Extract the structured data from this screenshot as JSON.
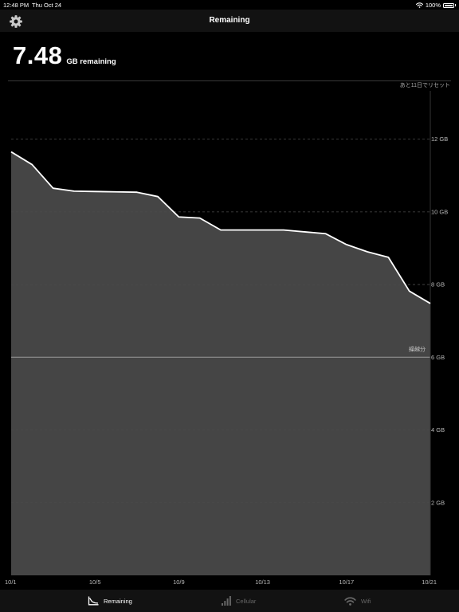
{
  "status_bar": {
    "time": "12:48 PM",
    "date": "Thu Oct 24",
    "battery": "100%"
  },
  "nav": {
    "title": "Remaining",
    "settings_icon": "gear-icon"
  },
  "summary": {
    "value": "7.48",
    "unit": "GB remaining"
  },
  "reset_note": "あと11日でリセット",
  "chart_data": {
    "type": "area",
    "x": [
      "10/1",
      "10/2",
      "10/3",
      "10/4",
      "10/5",
      "10/6",
      "10/7",
      "10/8",
      "10/9",
      "10/10",
      "10/11",
      "10/12",
      "10/13",
      "10/14",
      "10/15",
      "10/16",
      "10/17",
      "10/18",
      "10/19",
      "10/20",
      "10/21"
    ],
    "series": [
      {
        "values": [
          11.65,
          11.3,
          10.65,
          10.57,
          10.56,
          10.55,
          10.54,
          10.42,
          9.86,
          9.83,
          9.5,
          9.5,
          9.5,
          9.5,
          9.45,
          9.4,
          9.1,
          8.9,
          8.75,
          7.82,
          7.48
        ]
      }
    ],
    "x_tick_labels": [
      "10/1",
      "10/5",
      "10/9",
      "10/13",
      "10/17",
      "10/21"
    ],
    "y_tick_labels": [
      "2 GB",
      "4 GB",
      "6 GB",
      "8 GB",
      "10 GB",
      "12 GB"
    ],
    "ylim": [
      0,
      13
    ],
    "grid": true,
    "reference_line": {
      "value": 6,
      "label": "繰越分"
    },
    "colors": {
      "fill": "#454545",
      "line": "#ffffff",
      "grid": "#4a4a4a",
      "reference": "#9a9a9a"
    }
  },
  "tabs": [
    {
      "label": "Remaining",
      "icon": "area-chart-icon",
      "active": true
    },
    {
      "label": "Cellular",
      "icon": "cellular-bars-icon",
      "active": false
    },
    {
      "label": "Wifi",
      "icon": "wifi-icon",
      "active": false
    }
  ]
}
